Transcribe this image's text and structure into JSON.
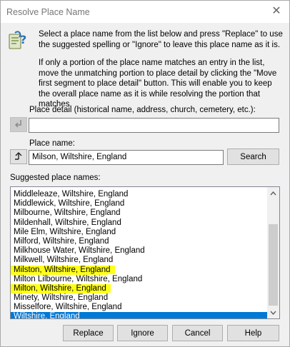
{
  "window": {
    "title": "Resolve Place Name",
    "close_glyph": "✕"
  },
  "instructions": {
    "line1": "Select a place name from the list below and press \"Replace\" to use the suggested spelling or \"Ignore\" to leave this place name as it is.",
    "line2": "If only a portion of the place name matches an entry in the list, move the unmatching portion to place detail by clicking the \"Move first segment to place detail\" button. This will enable you to keep the overall place name as it is while resolving the portion that matches."
  },
  "place_detail": {
    "label": "Place detail (historical name, address, church, cemetery, etc.):",
    "value": ""
  },
  "place_name": {
    "label": "Place name:",
    "value": "Milson, Wiltshire, England",
    "search_label": "Search"
  },
  "suggestions": {
    "label": "Suggested place names:",
    "items": [
      {
        "text": "Middleleaze, Wiltshire, England",
        "state": "normal"
      },
      {
        "text": "Middlewick, Wiltshire, England",
        "state": "normal"
      },
      {
        "text": "Milbourne, Wiltshire, England",
        "state": "normal"
      },
      {
        "text": "Mildenhall, Wiltshire, England",
        "state": "normal"
      },
      {
        "text": "Mile Elm, Wiltshire, England",
        "state": "normal"
      },
      {
        "text": "Milford, Wiltshire, England",
        "state": "normal"
      },
      {
        "text": "Milkhouse Water, Wiltshire, England",
        "state": "normal"
      },
      {
        "text": "Milkwell, Wiltshire, England",
        "state": "normal"
      },
      {
        "text": "Milston, Wiltshire, England",
        "state": "highlighted"
      },
      {
        "text": "Milton Lilbourne, Wiltshire, England",
        "state": "normal"
      },
      {
        "text": "Milton, Wiltshire, England",
        "state": "highlighted"
      },
      {
        "text": "Minety, Wiltshire, England",
        "state": "normal"
      },
      {
        "text": "Misselfore, Wiltshire, England",
        "state": "normal"
      },
      {
        "text": "Wiltshire, England",
        "state": "selected"
      }
    ]
  },
  "buttons": {
    "replace": "Replace",
    "ignore": "Ignore",
    "cancel": "Cancel",
    "help": "Help"
  },
  "colors": {
    "selection": "#0078d7",
    "highlight": "#ffff1a",
    "dialog_bg": "#f0f0f0"
  }
}
